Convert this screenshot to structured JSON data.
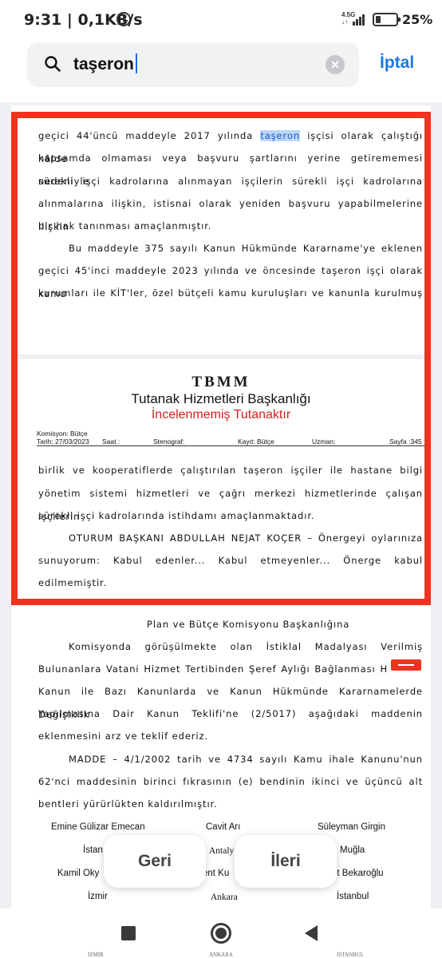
{
  "status_bar": {
    "time": "9:31",
    "speed": "0,1KB/s",
    "network": "4.5G",
    "network_sub": "↓↑",
    "battery": "25%"
  },
  "search": {
    "query": "taşeron",
    "cancel_label": "İptal"
  },
  "page1": {
    "lines": [
      "geçici 44'üncü maddeyle 2017 yılında ",
      "kapsamda olmaması veya başvuru şartlarını yerine getirememesi nedeniyle",
      "sürekli işçi kadrolarına alınmayan işçilerin sürekli işçi kadrolarına",
      "alınmalarına ilişkin, istisnai olarak yeniden başvuru yapabilmelerine ilişkin",
      "bir hak tanınması amaçlanmıştır.",
      "Bu maddeyle 375 sayılı Kanun Hükmünde Kararname'ye eklenen",
      "geçici 45'inci maddeyle 2023 yılında ve öncesinde taşeron işçi olarak kamu",
      "kurumları ile KİT'ler, özel bütçeli kamu kuruluşları ve kanunla kurulmuş"
    ],
    "highlight": "taşeron",
    "line1_rest": " işçisi olarak çalıştığı hâlde"
  },
  "header": {
    "org": "TBMM",
    "dept": "Tutanak Hizmetleri Başkanlığı",
    "status": "İncelenmemiş Tutanaktır",
    "komisyon": "Komisyon: Bütçe",
    "tarih": "Tarih: 27/03/2023",
    "saat": "Saat :",
    "stenograf": "Stenograf:",
    "kayit": "Kayıt: Bütçe",
    "uzman": "Uzman:",
    "sayfa": "Sayfa :345"
  },
  "page2": {
    "lines": [
      "birlik ve kooperatiflerde çalıştırılan taşeron işçiler ile hastane bilgi",
      "yönetim sistemi hizmetleri ve çağrı merkezi hizmetlerinde çalışan işçilerin",
      "sürekli işçi kadrolarında istihdamı amaçlanmaktadır.",
      "OTURUM BAŞKANI ABDULLAH NEJAT KOÇER – Önergeyi oylarınıza",
      "sunuyorum: Kabul edenler... Kabul etmeyenler... Önerge kabul",
      "edilmemiştir."
    ],
    "addressee": "Plan ve Bütçe Komisyonu Başkanlığına",
    "body": [
      "Komisyonda görüşülmekte olan İstiklal Madalyası Verilmiş",
      "Bulunanlara Vatani Hizmet Tertibinden Şeref Aylığı Bağlanması H",
      "Kanun ile Bazı Kanunlarda ve Kanun Hükmünde Kararnamelerde Değişiklik",
      "Yapılmasına Dair Kanun Teklifi'ne (2/5017) aşağıdaki maddenin",
      "eklenmesini arz ve teklif ederiz.",
      "MADDE – 4/1/2002 tarih ve 4734 sayılı Kamu ihale Kanunu'nun",
      "62'nci maddesinin birinci fıkrasının (e) bendinin ikinci ve üçüncü alt",
      "bentleri yürürlükten kaldırılmıştır."
    ],
    "signers": {
      "row1": [
        "Emine Gülizar Emecan",
        "Cavit Arı",
        "Süleyman Girgin"
      ],
      "row2": [
        "İstan",
        "Antaly",
        "Muğla"
      ],
      "row3": [
        "Kamil Oky",
        "ent Ku",
        "et Bekaroğlu"
      ],
      "row4": [
        "İzmir",
        "Ankara",
        "İstanbul"
      ]
    }
  },
  "buttons": {
    "prev": "Geri",
    "next": "İleri"
  },
  "bottom_clip": [
    "İZMİR",
    "ANKARA",
    "İSTANBUL"
  ]
}
